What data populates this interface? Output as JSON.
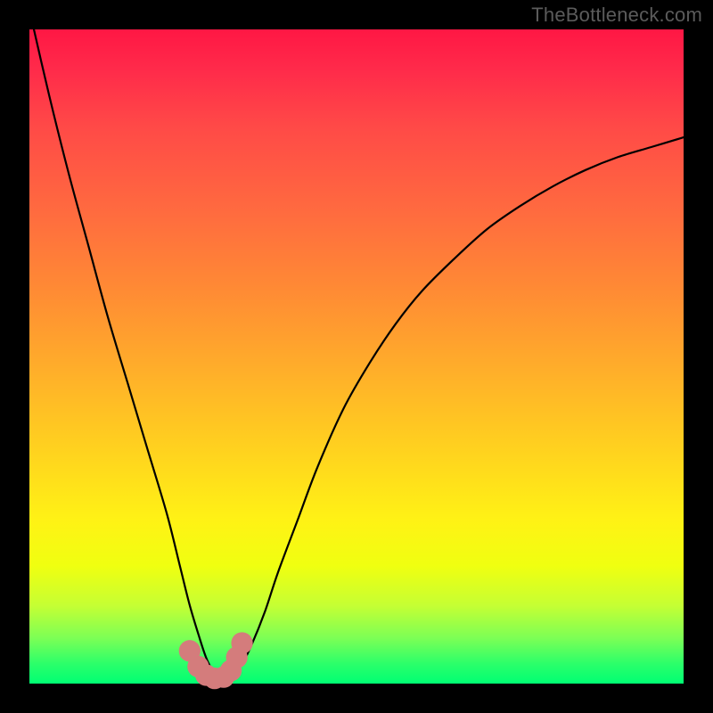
{
  "watermark": "TheBottleneck.com",
  "chart_data": {
    "type": "line",
    "title": "",
    "xlabel": "",
    "ylabel": "",
    "xlim": [
      0,
      100
    ],
    "ylim": [
      0,
      100
    ],
    "grid": false,
    "legend": false,
    "series": [
      {
        "name": "curve",
        "x": [
          0,
          3,
          6,
          9,
          12,
          15,
          18,
          21,
          23,
          24.5,
          26,
          27,
          28,
          29,
          30,
          31,
          32.5,
          34,
          36,
          38,
          41,
          44,
          48,
          52,
          56,
          60,
          65,
          70,
          75,
          80,
          85,
          90,
          95,
          100
        ],
        "y": [
          103,
          90,
          78,
          67,
          56,
          46,
          36,
          26,
          18,
          12,
          7,
          4,
          2,
          1,
          1,
          1.5,
          3,
          6,
          11,
          17,
          25,
          33,
          42,
          49,
          55,
          60,
          65,
          69.5,
          73,
          76,
          78.5,
          80.5,
          82,
          83.5
        ]
      }
    ],
    "markers": [
      {
        "x": 24.5,
        "y": 5,
        "r": 1.4
      },
      {
        "x": 25.8,
        "y": 2.6,
        "r": 1.4
      },
      {
        "x": 27.0,
        "y": 1.3,
        "r": 1.4
      },
      {
        "x": 28.3,
        "y": 0.8,
        "r": 1.4
      },
      {
        "x": 29.7,
        "y": 1.0,
        "r": 1.4
      },
      {
        "x": 30.8,
        "y": 2.0,
        "r": 1.4
      },
      {
        "x": 31.7,
        "y": 4.0,
        "r": 1.4
      },
      {
        "x": 32.5,
        "y": 6.2,
        "r": 1.4
      }
    ],
    "gradient_stops": [
      {
        "pct": 0,
        "color": "#ff1744"
      },
      {
        "pct": 15,
        "color": "#ff4a47"
      },
      {
        "pct": 40,
        "color": "#ff8b34"
      },
      {
        "pct": 64,
        "color": "#ffd11f"
      },
      {
        "pct": 82,
        "color": "#f0ff10"
      },
      {
        "pct": 100,
        "color": "#00ff73"
      }
    ]
  }
}
